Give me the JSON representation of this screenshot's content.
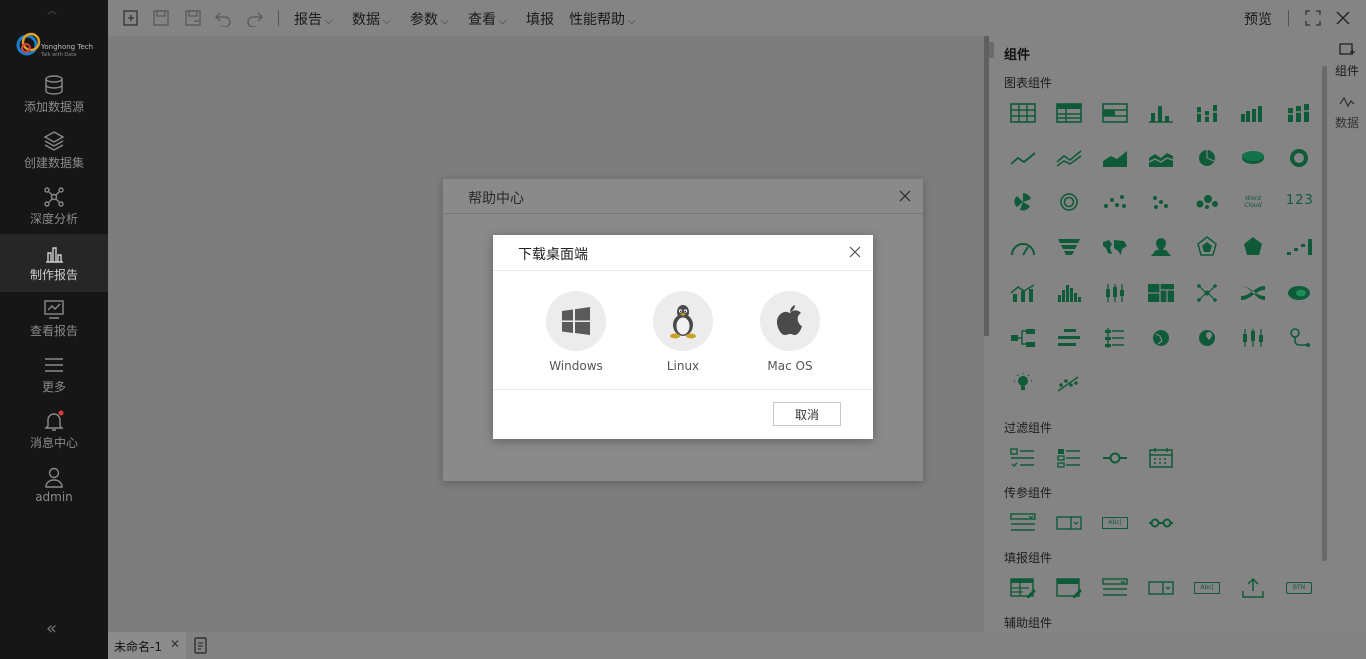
{
  "sidebar": {
    "brand": {
      "name": "Yonghong Tech",
      "tagline": "Talk with Data"
    },
    "items": [
      {
        "label": "添加数据源",
        "icon": "database-icon"
      },
      {
        "label": "创建数据集",
        "icon": "layers-icon"
      },
      {
        "label": "深度分析",
        "icon": "network-icon"
      },
      {
        "label": "制作报告",
        "icon": "bar-chart-icon",
        "active": true
      },
      {
        "label": "查看报告",
        "icon": "monitor-chart-icon"
      },
      {
        "label": "更多",
        "icon": "menu-icon"
      },
      {
        "label": "消息中心",
        "icon": "bell-icon"
      },
      {
        "label": "admin",
        "icon": "user-icon"
      }
    ],
    "collapse_glyph": "«"
  },
  "toolbar": {
    "menus": [
      {
        "label": "报告",
        "has_caret": true
      },
      {
        "label": "数据",
        "has_caret": true
      },
      {
        "label": "参数",
        "has_caret": true
      },
      {
        "label": "查看",
        "has_caret": true
      },
      {
        "label": "填报",
        "has_caret": false
      },
      {
        "label": "性能帮助",
        "has_caret": true
      }
    ],
    "preview_label": "预览"
  },
  "panel": {
    "title": "组件",
    "sections": {
      "chart": "图表组件",
      "filter": "过滤组件",
      "param": "传参组件",
      "fill": "填报组件",
      "aux": "辅助组件"
    },
    "wordcloud_text": "Word Cloud",
    "number_text": "123",
    "abc_text": "Abc|",
    "btn_text": "BTN",
    "accent": "#1f8a5a"
  },
  "rightbar": {
    "tab_components": "组件",
    "tab_data": "数据"
  },
  "bottom": {
    "tab_label": "未命名-1"
  },
  "help_dialog": {
    "title": "帮助中心"
  },
  "download_dialog": {
    "title": "下载桌面端",
    "options": [
      {
        "label": "Windows",
        "icon": "windows-icon"
      },
      {
        "label": "Linux",
        "icon": "linux-tux-icon"
      },
      {
        "label": "Mac OS",
        "icon": "apple-icon"
      }
    ],
    "cancel_label": "取消"
  }
}
